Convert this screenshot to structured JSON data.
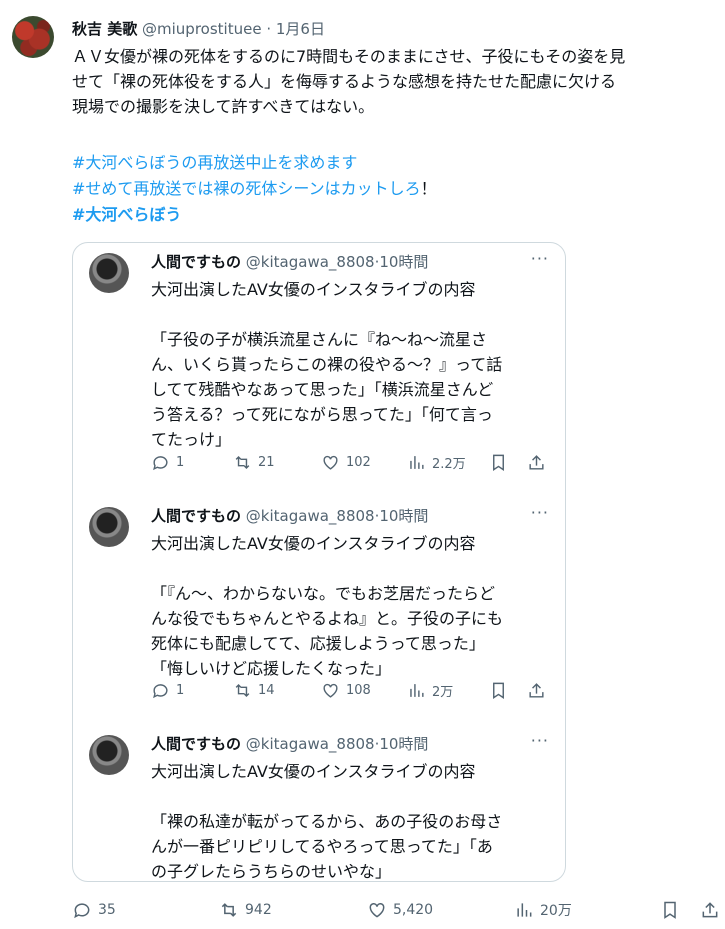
{
  "author": {
    "name": "秋吉 美歌",
    "handle": "@miuprostituee",
    "separator": "·",
    "date": "1月6日"
  },
  "body": "ＡＶ女優が裸の死体をするのに7時間もそのままにさせ、子役にもその姿を見\nせて「裸の死体役をする人」を侮辱するような感想を持たせた配慮に欠ける\n現場での撮影を決して許すべきてはない。",
  "hashtags": {
    "line1": "#大河べらぼうの再放送中止を求めます",
    "line2": "#せめて再放送では裸の死体シーンはカットしろ",
    "line2_suffix": "！",
    "line3": "#大河べらぼう"
  },
  "quoted": [
    {
      "name": "人間ですもの",
      "handle": "@kitagawa_8808",
      "time": "·10時間",
      "more": "···",
      "text": "大河出演したAV女優のインスタライブの内容\n\n「子役の子が横浜流星さんに『ね～ね～流星さ\nん、いくら貰ったらこの裸の役やる～？』って話\nしてて残酷やなあって思った」「横浜流星さんど\nう答える？って死にながら思ってた」「何て言っ\nてたっけ」",
      "replies": "1",
      "reposts": "21",
      "likes": "102",
      "views": "2.2万"
    },
    {
      "name": "人間ですもの",
      "handle": "@kitagawa_8808",
      "time": "·10時間",
      "more": "···",
      "text": "大河出演したAV女優のインスタライブの内容\n\n「『ん～、わからないな。でもお芝居だったらど\nんな役でもちゃんとやるよね』と。子役の子にも\n死体にも配慮してて、応援しようって思った」\n「悔しいけど応援したくなった」",
      "replies": "1",
      "reposts": "14",
      "likes": "108",
      "views": "2万"
    },
    {
      "name": "人間ですもの",
      "handle": "@kitagawa_8808",
      "time": "·10時間",
      "more": "···",
      "text": "大河出演したAV女優のインスタライブの内容\n\n「裸の私達が転がってるから、あの子役のお母さ\nんが一番ピリピリしてるやろって思ってた」「あ\nの子グレたらうちらのせいやな」"
    }
  ],
  "stats": {
    "replies": "35",
    "reposts": "942",
    "likes": "5,420",
    "views": "20万"
  },
  "icons": [
    "reply-icon",
    "repost-icon",
    "like-icon",
    "views-icon",
    "bookmark-icon",
    "share-icon"
  ],
  "colors": {
    "link": "#1d9bf0",
    "muted": "#536471",
    "border": "#cfd9de"
  }
}
